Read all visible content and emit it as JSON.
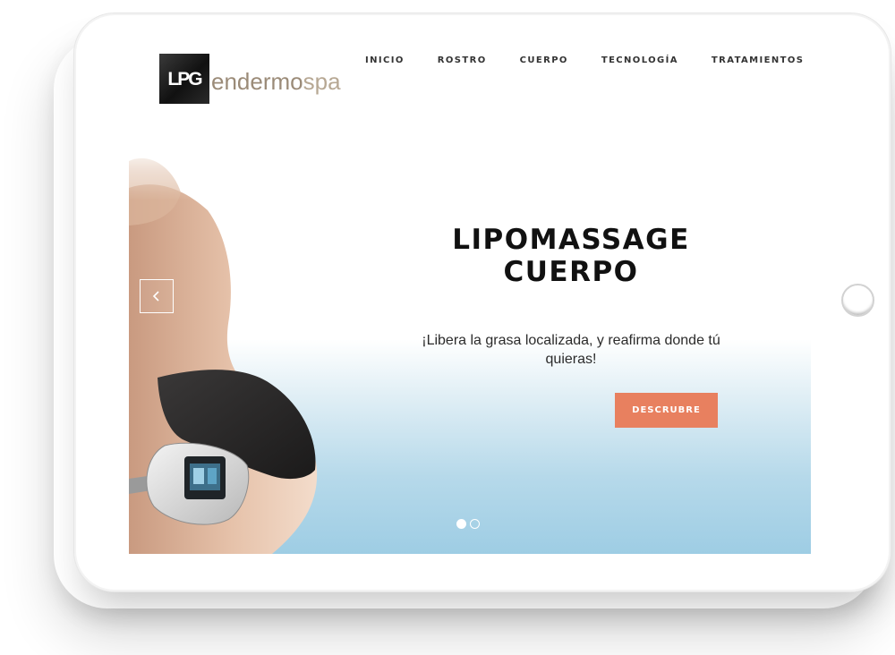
{
  "logo": {
    "mark": "LPG",
    "text_dark": "endermo",
    "text_light": "spa"
  },
  "nav": {
    "items": [
      {
        "label": "INICIO"
      },
      {
        "label": "ROSTRO"
      },
      {
        "label": "CUERPO"
      },
      {
        "label": "TECNOLOGÍA"
      },
      {
        "label": "TRATAMIENTOS"
      }
    ]
  },
  "hero": {
    "title_line1": "LIPOMASSAGE",
    "title_line2": "CUERPO",
    "subtitle": "¡Libera la grasa localizada, y reafirma donde tú quieras!",
    "cta_label": "DESCRUBRE",
    "slides_total": 2,
    "active_slide": 1
  },
  "icons": {
    "prev": "chevron-left-icon",
    "home_button": "home-button-icon",
    "hero_image": "body-treatment-image"
  },
  "colors": {
    "accent": "#e8805f",
    "hero_gradient_bottom": "#9ecde4",
    "logo_text": "#9b8b78",
    "nav_text": "#333333",
    "title_text": "#111111"
  }
}
